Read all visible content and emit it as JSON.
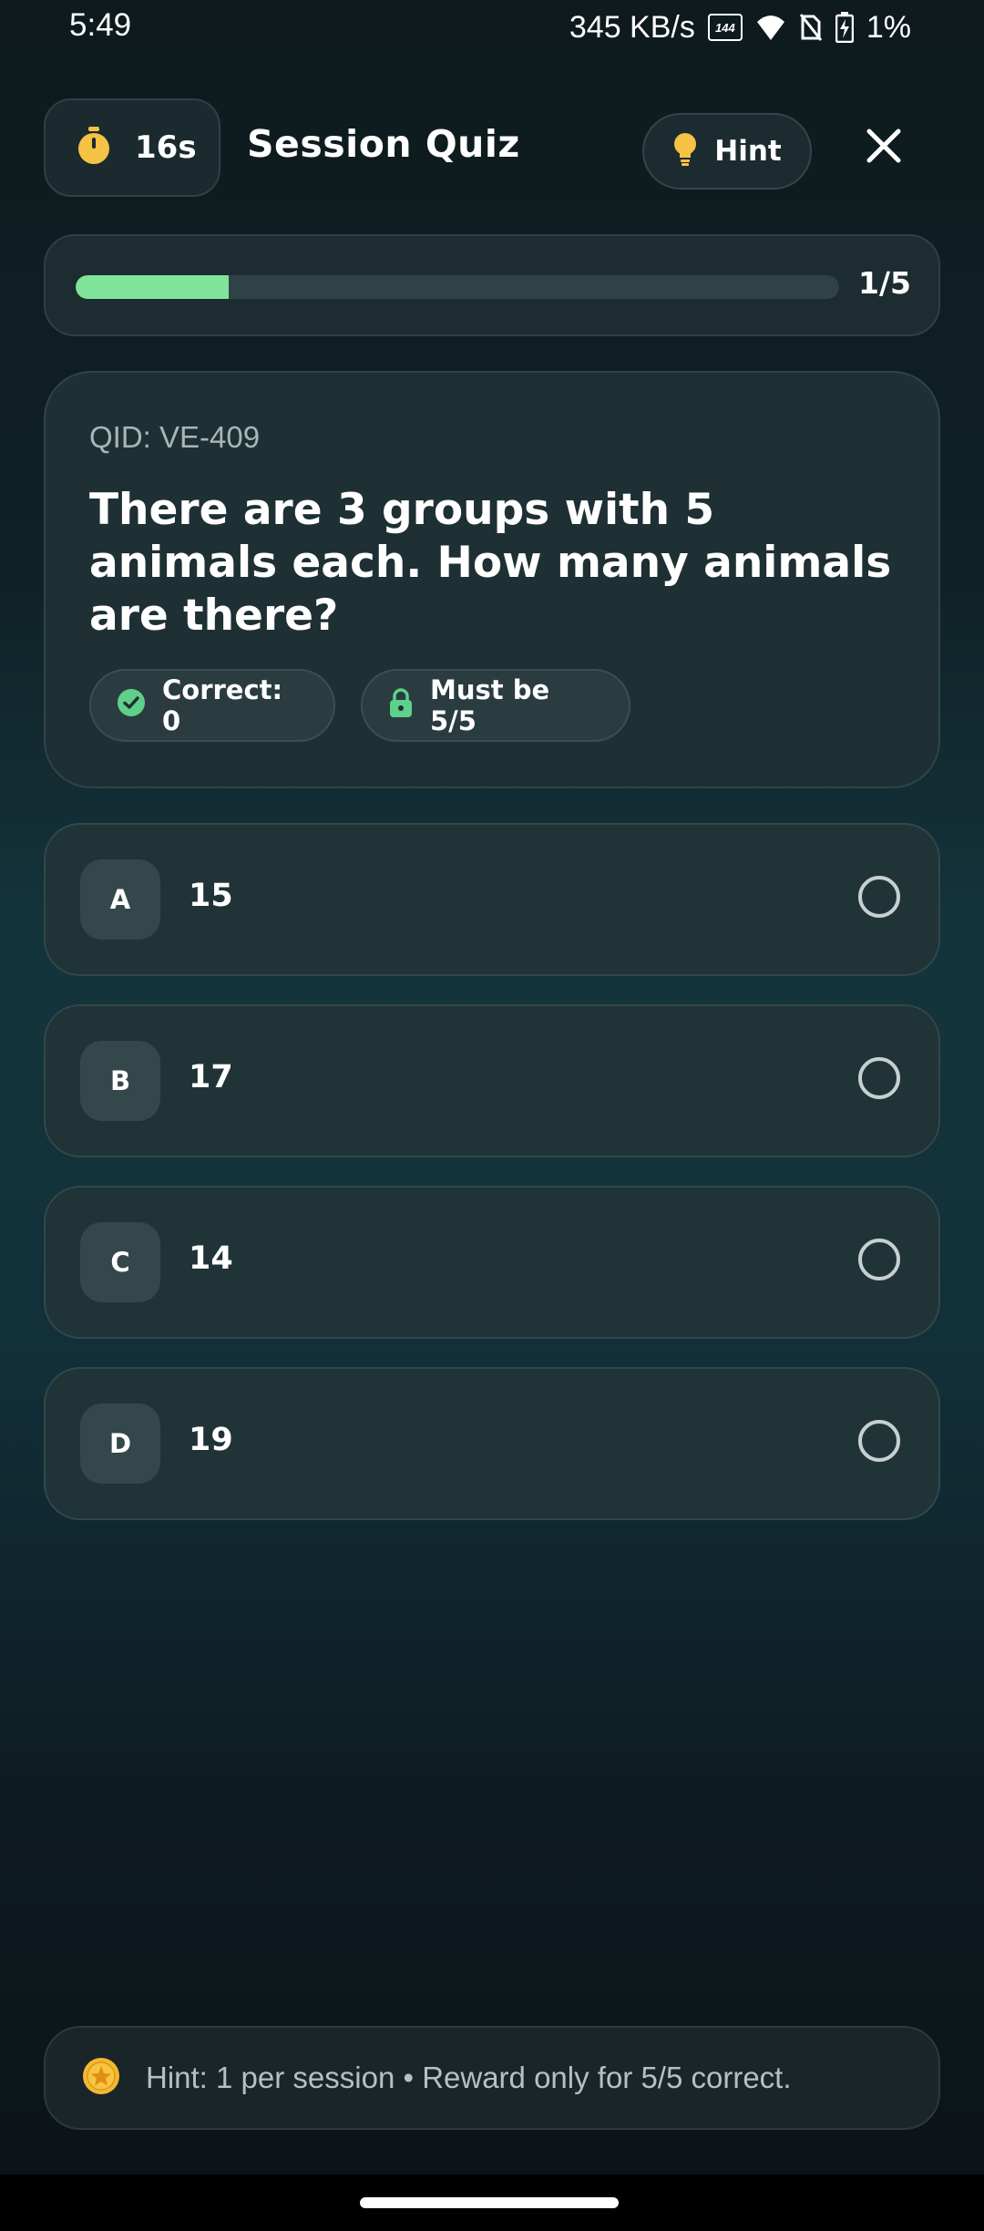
{
  "status_bar": {
    "time": "5:49",
    "network_speed": "345 KB/s",
    "refresh_rate": "144",
    "battery": "1%"
  },
  "header": {
    "timer": "16s",
    "title": "Session Quiz",
    "hint_label": "Hint"
  },
  "progress": {
    "text": "1/5",
    "current": 1,
    "total": 5
  },
  "question": {
    "qid": "QID: VE-409",
    "text": "There are 3 groups with 5 animals each. How many animals are there?",
    "correct_chip": "Correct: 0",
    "requirement_chip": "Must be 5/5"
  },
  "options": [
    {
      "letter": "A",
      "text": "15"
    },
    {
      "letter": "B",
      "text": "17"
    },
    {
      "letter": "C",
      "text": "14"
    },
    {
      "letter": "D",
      "text": "19"
    }
  ],
  "footer": {
    "hint_text": "Hint: 1 per session • Reward only for 5/5 correct."
  },
  "colors": {
    "accent_green": "#7fe39a",
    "check_green": "#5fd08a",
    "timer_yellow": "#f6c244",
    "coin_yellow": "#f5b82e"
  },
  "icons": {
    "timer": "stopwatch-icon",
    "hint": "lightbulb-icon",
    "close": "close-icon",
    "correct": "check-circle-icon",
    "requirement": "lock-icon",
    "footer": "coin-star-icon"
  }
}
